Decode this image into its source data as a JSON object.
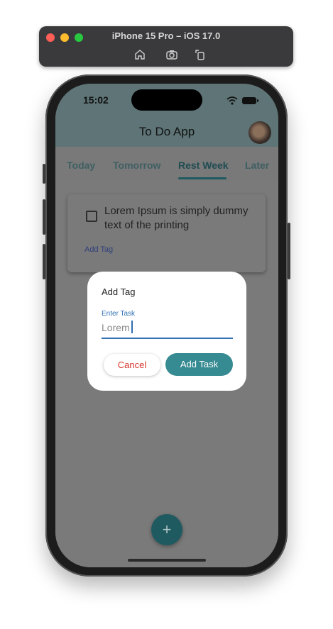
{
  "simulator": {
    "title": "iPhone 15 Pro – iOS 17.0",
    "toolbar_icons": [
      "home-icon",
      "screenshot-icon",
      "rotate-icon"
    ]
  },
  "status_bar": {
    "time": "15:02",
    "icons": [
      "wifi-icon",
      "battery-icon"
    ]
  },
  "app": {
    "title": "To Do App",
    "avatar": "user-avatar"
  },
  "tabs": [
    {
      "label": "Today",
      "active": false
    },
    {
      "label": "Tomorrow",
      "active": false
    },
    {
      "label": "Rest Week",
      "active": true
    },
    {
      "label": "Later",
      "active": false
    }
  ],
  "task_card": {
    "text": "Lorem Ipsum is simply dummy text of the printing",
    "checked": false,
    "add_tag_label": "Add Tag"
  },
  "dialog": {
    "title": "Add Tag",
    "field_label": "Enter Task",
    "field_value": "Lorem",
    "cancel_label": "Cancel",
    "submit_label": "Add Task"
  },
  "fab": {
    "label": "+"
  },
  "colors": {
    "accent": "#368a91",
    "accent_dark": "#1f5a60",
    "cancel_red": "#d6352c",
    "focus_blue": "#2f6fb2"
  }
}
